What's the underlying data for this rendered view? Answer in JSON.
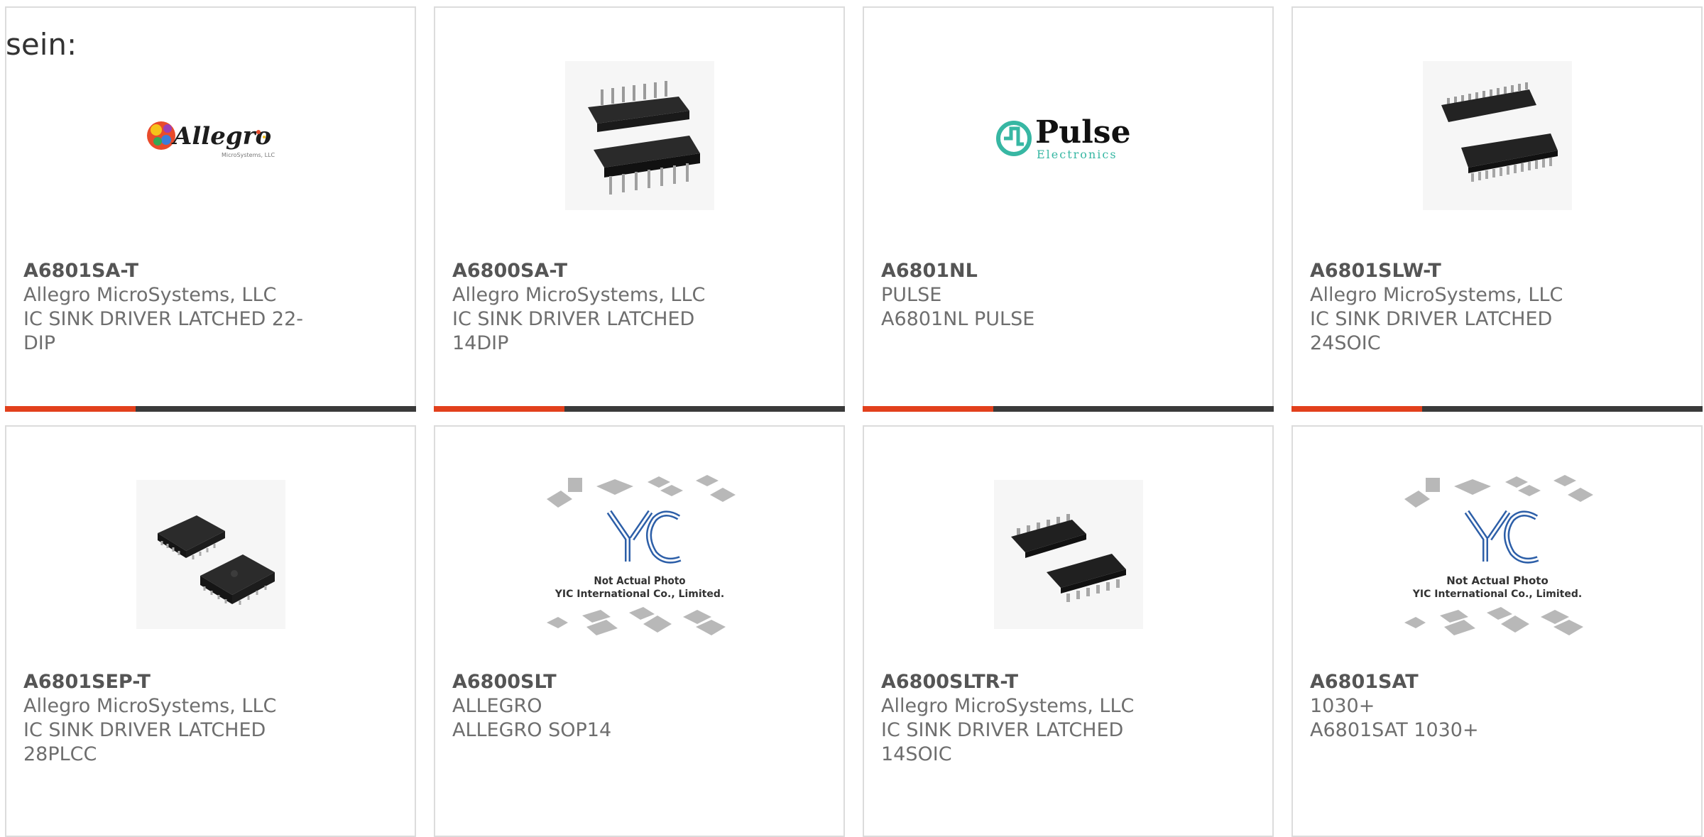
{
  "lead_text": "sein:",
  "colors": {
    "accent": "#e2401c",
    "bar": "#3a3a3a",
    "border": "#dcdcdc",
    "text": "#6e6e6e"
  },
  "products": [
    {
      "part": "A6801SA-T",
      "maker": "Allegro MicroSystems, LLC",
      "desc": "IC SINK DRIVER LATCHED 22-DIP",
      "image": "allegro-logo",
      "logo_text": "Allegro",
      "logo_sub": "MicroSystems, LLC"
    },
    {
      "part": "A6800SA-T",
      "maker": "Allegro MicroSystems, LLC",
      "desc": "IC SINK DRIVER LATCHED 14DIP",
      "image": "dip-chip-photo"
    },
    {
      "part": "A6801NL",
      "maker": "PULSE",
      "desc": "A6801NL PULSE",
      "image": "pulse-logo",
      "logo_text": "Pulse",
      "logo_sub": "Electronics"
    },
    {
      "part": "A6801SLW-T",
      "maker": "Allegro MicroSystems, LLC",
      "desc": "IC SINK DRIVER LATCHED 24SOIC",
      "image": "soic-chip-photo"
    },
    {
      "part": "A6801SEP-T",
      "maker": "Allegro MicroSystems, LLC",
      "desc": "IC SINK DRIVER LATCHED 28PLCC",
      "image": "plcc-chip-photo"
    },
    {
      "part": "A6800SLT",
      "maker": "ALLEGRO",
      "desc": "ALLEGRO SOP14",
      "image": "not-actual-photo",
      "ph_line1": "Not Actual Photo",
      "ph_line2": "YIC International Co., Limited."
    },
    {
      "part": "A6800SLTR-T",
      "maker": "Allegro MicroSystems, LLC",
      "desc": "IC SINK DRIVER LATCHED 14SOIC",
      "image": "soic-chip-photo"
    },
    {
      "part": "A6801SAT",
      "maker": "1030+",
      "desc": "A6801SAT 1030+",
      "image": "not-actual-photo",
      "ph_line1": "Not Actual Photo",
      "ph_line2": "YIC International Co., Limited."
    }
  ]
}
